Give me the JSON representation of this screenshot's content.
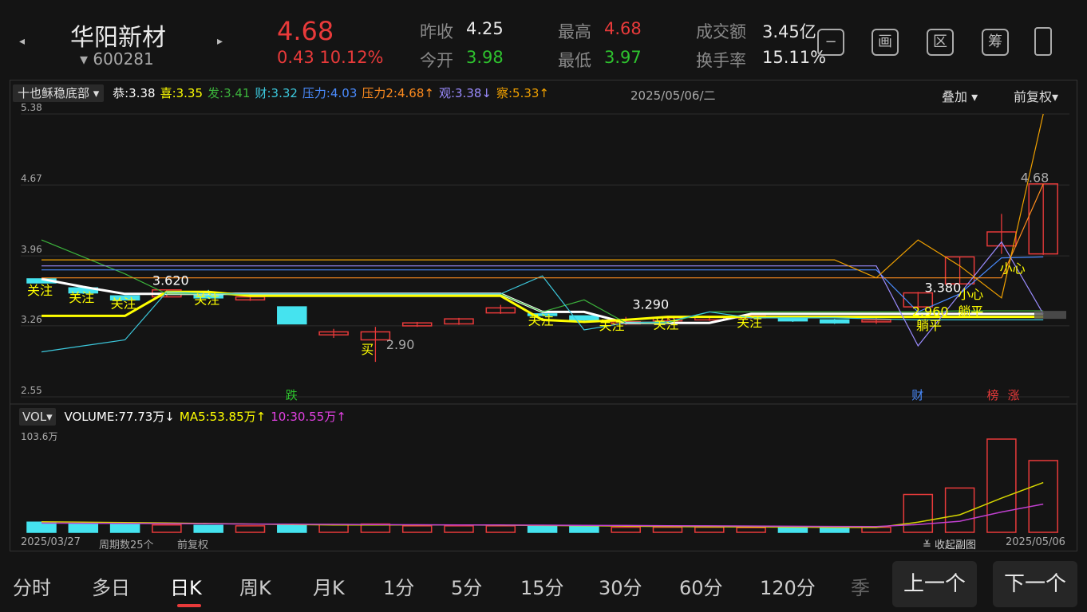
{
  "header": {
    "stock_name": "华阳新材",
    "stock_code": "▾ 600281",
    "price": "4.68",
    "change": "0.43  10.12%",
    "quotes": [
      {
        "label": "昨收",
        "value": "4.25",
        "color": "white"
      },
      {
        "label": "今开",
        "value": "3.98",
        "color": "green"
      },
      {
        "label": "最高",
        "value": "4.68",
        "color": "red"
      },
      {
        "label": "最低",
        "value": "3.97",
        "color": "green"
      },
      {
        "label": "成交额",
        "value": "3.45亿",
        "color": "white"
      },
      {
        "label": "换手率",
        "value": "15.11%",
        "color": "white"
      }
    ],
    "tools": [
      "−",
      "画",
      "区",
      "筹"
    ]
  },
  "indicator_bar": {
    "select": "十也稣稳底部",
    "items": [
      {
        "text": "恭:3.38",
        "color": "#ffffff"
      },
      {
        "text": "喜:3.35",
        "color": "#ffff00"
      },
      {
        "text": "发:3.41",
        "color": "#3cb43c"
      },
      {
        "text": "财:3.32",
        "color": "#3cc8dc"
      },
      {
        "text": "压力:4.03",
        "color": "#4a8cff"
      },
      {
        "text": "压力2:4.68↑",
        "color": "#ff8c1e"
      },
      {
        "text": "观:3.38↓",
        "color": "#9b8cff"
      },
      {
        "text": "察:5.33↑",
        "color": "#f0a000"
      }
    ],
    "date": "2025/05/06/二",
    "overlay": "叠加",
    "adjust": "前复权"
  },
  "vol_bar": {
    "select": "VOL",
    "items": [
      {
        "text": "VOLUME:77.73万↓",
        "color": "#ffffff"
      },
      {
        "text": "MA5:53.85万↑",
        "color": "#ffff00"
      },
      {
        "text": "10:30.55万↑",
        "color": "#e040e0"
      }
    ]
  },
  "chart_data": {
    "type": "candlestick",
    "y_ticks": [
      "5.38",
      "4.67",
      "3.96",
      "3.26",
      "2.55"
    ],
    "ylim": [
      2.55,
      5.38
    ],
    "vol_max_label": "103.6万",
    "vol_max": 103.6,
    "start_date": "2025/03/27",
    "end_date": "2025/05/06",
    "period_count": "周期数25个",
    "adjust": "前复权",
    "collapse": "收起副图",
    "candles": [
      {
        "o": 3.73,
        "c": 3.69,
        "h": 3.73,
        "l": 3.69,
        "v": 11.0
      },
      {
        "o": 3.64,
        "c": 3.59,
        "h": 3.64,
        "l": 3.58,
        "v": 9.0
      },
      {
        "o": 3.56,
        "c": 3.52,
        "h": 3.56,
        "l": 3.52,
        "v": 8.5
      },
      {
        "o": 3.55,
        "c": 3.62,
        "h": 3.62,
        "l": 3.55,
        "v": 8.0
      },
      {
        "o": 3.58,
        "c": 3.54,
        "h": 3.62,
        "l": 3.53,
        "v": 7.5
      },
      {
        "o": 3.52,
        "c": 3.55,
        "h": 3.56,
        "l": 3.51,
        "v": 7.0
      },
      {
        "o": 3.45,
        "c": 3.28,
        "h": 3.45,
        "l": 3.28,
        "v": 7.5
      },
      {
        "o": 3.17,
        "c": 3.2,
        "h": 3.23,
        "l": 3.14,
        "v": 8.5
      },
      {
        "o": 3.12,
        "c": 3.2,
        "h": 3.25,
        "l": 2.9,
        "v": 9.0
      },
      {
        "o": 3.26,
        "c": 3.29,
        "h": 3.3,
        "l": 3.25,
        "v": 7.0
      },
      {
        "o": 3.28,
        "c": 3.33,
        "h": 3.34,
        "l": 3.27,
        "v": 7.0
      },
      {
        "o": 3.39,
        "c": 3.44,
        "h": 3.47,
        "l": 3.38,
        "v": 7.0
      },
      {
        "o": 3.38,
        "c": 3.37,
        "h": 3.39,
        "l": 3.36,
        "v": 6.5
      },
      {
        "o": 3.36,
        "c": 3.32,
        "h": 3.36,
        "l": 3.29,
        "v": 6.5
      },
      {
        "o": 3.28,
        "c": 3.3,
        "h": 3.35,
        "l": 3.27,
        "v": 5.5
      },
      {
        "o": 3.31,
        "c": 3.34,
        "h": 3.35,
        "l": 3.3,
        "v": 5.5
      },
      {
        "o": 3.32,
        "c": 3.35,
        "h": 3.36,
        "l": 3.31,
        "v": 5.5
      },
      {
        "o": 3.34,
        "c": 3.36,
        "h": 3.37,
        "l": 3.33,
        "v": 5.0
      },
      {
        "o": 3.33,
        "c": 3.31,
        "h": 3.34,
        "l": 3.3,
        "v": 5.0
      },
      {
        "o": 3.32,
        "c": 3.29,
        "h": 3.33,
        "l": 3.28,
        "v": 5.0
      },
      {
        "o": 3.3,
        "c": 3.32,
        "h": 3.34,
        "l": 3.28,
        "v": 5.5
      },
      {
        "o": 3.45,
        "c": 3.59,
        "h": 3.6,
        "l": 3.38,
        "v": 41.0
      },
      {
        "o": 3.68,
        "c": 3.95,
        "h": 3.95,
        "l": 3.68,
        "v": 48.0
      },
      {
        "o": 4.06,
        "c": 4.2,
        "h": 4.38,
        "l": 3.98,
        "v": 101.0
      },
      {
        "o": 3.98,
        "c": 4.68,
        "h": 4.68,
        "l": 3.97,
        "v": 77.73
      }
    ],
    "annotations": [
      {
        "text": "关注",
        "i": 0,
        "y": 3.57,
        "color": "#ffff00"
      },
      {
        "text": "关注",
        "i": 1,
        "y": 3.5,
        "color": "#ffff00"
      },
      {
        "text": "关注",
        "i": 2,
        "y": 3.44,
        "color": "#ffff00"
      },
      {
        "text": "3.620",
        "i": 3,
        "y": 3.67,
        "color": "#ffffff"
      },
      {
        "text": "关注",
        "i": 4,
        "y": 3.48,
        "color": "#ffff00"
      },
      {
        "text": "买",
        "i": 8,
        "y": 2.98,
        "color": "#ffff00"
      },
      {
        "text": "2.90",
        "i": 8.6,
        "y": 3.03,
        "color": "#aaaaaa"
      },
      {
        "text": "关注",
        "i": 12,
        "y": 3.27,
        "color": "#ffff00"
      },
      {
        "text": "3.290",
        "i": 14.5,
        "y": 3.43,
        "color": "#ffffff"
      },
      {
        "text": "关注",
        "i": 13.7,
        "y": 3.22,
        "color": "#ffff00"
      },
      {
        "text": "关注",
        "i": 15,
        "y": 3.23,
        "color": "#ffff00"
      },
      {
        "text": "关注",
        "i": 17,
        "y": 3.25,
        "color": "#ffff00"
      },
      {
        "text": "3.380",
        "i": 21.5,
        "y": 3.6,
        "color": "#ffffff"
      },
      {
        "text": "2.960",
        "i": 21.2,
        "y": 3.36,
        "color": "#ffff00"
      },
      {
        "text": "躺平",
        "i": 21.3,
        "y": 3.22,
        "color": "#ffff00"
      },
      {
        "text": "小心",
        "i": 22.3,
        "y": 3.53,
        "color": "#ffff00"
      },
      {
        "text": "躺平",
        "i": 22.3,
        "y": 3.36,
        "color": "#ffff00"
      },
      {
        "text": "小心",
        "i": 23.3,
        "y": 3.79,
        "color": "#ffff00"
      },
      {
        "text": "4.68",
        "i": 23.8,
        "y": 4.7,
        "color": "#aaaaaa"
      }
    ],
    "markers": [
      {
        "text": "跌",
        "i": 6,
        "color": "#2ec22e"
      },
      {
        "text": "财",
        "i": 21,
        "color": "#4a8cff"
      },
      {
        "text": "榜",
        "i": 22.8,
        "color": "#e83a3a"
      },
      {
        "text": "涨",
        "i": 23.3,
        "color": "#e83a3a"
      }
    ],
    "lines": [
      {
        "name": "恭",
        "color": "#ffffff",
        "width": 3,
        "pts": [
          3.73,
          3.65,
          3.58,
          3.58,
          3.58,
          3.58,
          3.58,
          3.58,
          3.58,
          3.58,
          3.58,
          3.58,
          3.4,
          3.4,
          3.29,
          3.29,
          3.29,
          3.38,
          3.38,
          3.38,
          3.38,
          3.38,
          3.38,
          3.38,
          3.38
        ]
      },
      {
        "name": "喜",
        "color": "#ffff00",
        "width": 3,
        "pts": [
          3.36,
          3.36,
          3.36,
          3.6,
          3.6,
          3.56,
          3.56,
          3.56,
          3.56,
          3.56,
          3.56,
          3.56,
          3.32,
          3.3,
          3.32,
          3.35,
          3.35,
          3.35,
          3.35,
          3.35,
          3.35,
          3.35,
          3.35,
          3.35,
          3.35
        ]
      },
      {
        "name": "发",
        "color": "#3cb43c",
        "width": 1.2,
        "pts": [
          4.12,
          3.95,
          3.78,
          3.58,
          3.58,
          3.58,
          3.58,
          3.58,
          3.58,
          3.58,
          3.58,
          3.58,
          3.4,
          3.52,
          3.29,
          3.29,
          3.4,
          3.4,
          3.4,
          3.4,
          3.4,
          3.4,
          3.41,
          3.41,
          3.41
        ]
      },
      {
        "name": "财",
        "color": "#3cc8dc",
        "width": 1.2,
        "pts": [
          3.0,
          3.06,
          3.12,
          3.6,
          3.58,
          3.58,
          3.58,
          3.58,
          3.58,
          3.58,
          3.58,
          3.58,
          3.76,
          3.22,
          3.29,
          3.3,
          3.4,
          3.34,
          3.34,
          3.34,
          3.33,
          3.32,
          3.32,
          3.32,
          3.32
        ]
      },
      {
        "name": "压力",
        "color": "#4a8cff",
        "width": 1.2,
        "pts": [
          3.82,
          3.82,
          3.82,
          3.82,
          3.82,
          3.82,
          3.82,
          3.82,
          3.82,
          3.82,
          3.82,
          3.82,
          3.82,
          3.82,
          3.82,
          3.82,
          3.82,
          3.82,
          3.82,
          3.82,
          3.82,
          3.4,
          3.58,
          3.94,
          3.95
        ]
      },
      {
        "name": "压力2",
        "color": "#ff8c1e",
        "width": 1.2,
        "pts": [
          3.74,
          3.74,
          3.74,
          3.74,
          3.74,
          3.74,
          3.74,
          3.74,
          3.74,
          3.74,
          3.74,
          3.74,
          3.74,
          3.74,
          3.74,
          3.74,
          3.74,
          3.74,
          3.74,
          3.74,
          3.74,
          3.74,
          3.74,
          3.74,
          4.68
        ]
      },
      {
        "name": "观",
        "color": "#9b8cff",
        "width": 1.2,
        "pts": [
          3.86,
          3.86,
          3.86,
          3.86,
          3.86,
          3.86,
          3.86,
          3.86,
          3.86,
          3.86,
          3.86,
          3.86,
          3.86,
          3.86,
          3.86,
          3.86,
          3.86,
          3.86,
          3.86,
          3.86,
          3.86,
          3.06,
          3.58,
          4.1,
          3.38
        ]
      },
      {
        "name": "察",
        "color": "#f0a000",
        "width": 1.2,
        "pts": [
          3.92,
          3.92,
          3.92,
          3.92,
          3.92,
          3.92,
          3.92,
          3.92,
          3.92,
          3.92,
          3.92,
          3.92,
          3.92,
          3.92,
          3.92,
          3.92,
          3.92,
          3.92,
          3.92,
          3.92,
          3.74,
          4.12,
          3.86,
          3.54,
          5.38
        ]
      }
    ],
    "ma5": [
      11.5,
      11.0,
      10.6,
      10.2,
      9.6,
      9.0,
      8.4,
      8.0,
      7.9,
      7.9,
      7.9,
      7.8,
      7.4,
      7.1,
      6.7,
      6.3,
      6.0,
      5.8,
      5.6,
      5.3,
      5.2,
      11.0,
      19.0,
      37.0,
      53.85
    ],
    "ma10": [
      10.0,
      9.8,
      9.6,
      9.4,
      9.2,
      9.0,
      8.8,
      8.6,
      8.4,
      8.2,
      8.0,
      7.9,
      7.8,
      7.6,
      7.4,
      7.2,
      7.0,
      6.8,
      6.6,
      6.4,
      6.2,
      8.5,
      12.0,
      22.0,
      30.55
    ]
  },
  "bottom_tabs": [
    "分时",
    "多日",
    "日K",
    "周K",
    "月K",
    "1分",
    "5分",
    "15分",
    "30分",
    "60分",
    "120分",
    "季"
  ],
  "nav": {
    "prev": "上一个",
    "next": "下一个"
  }
}
